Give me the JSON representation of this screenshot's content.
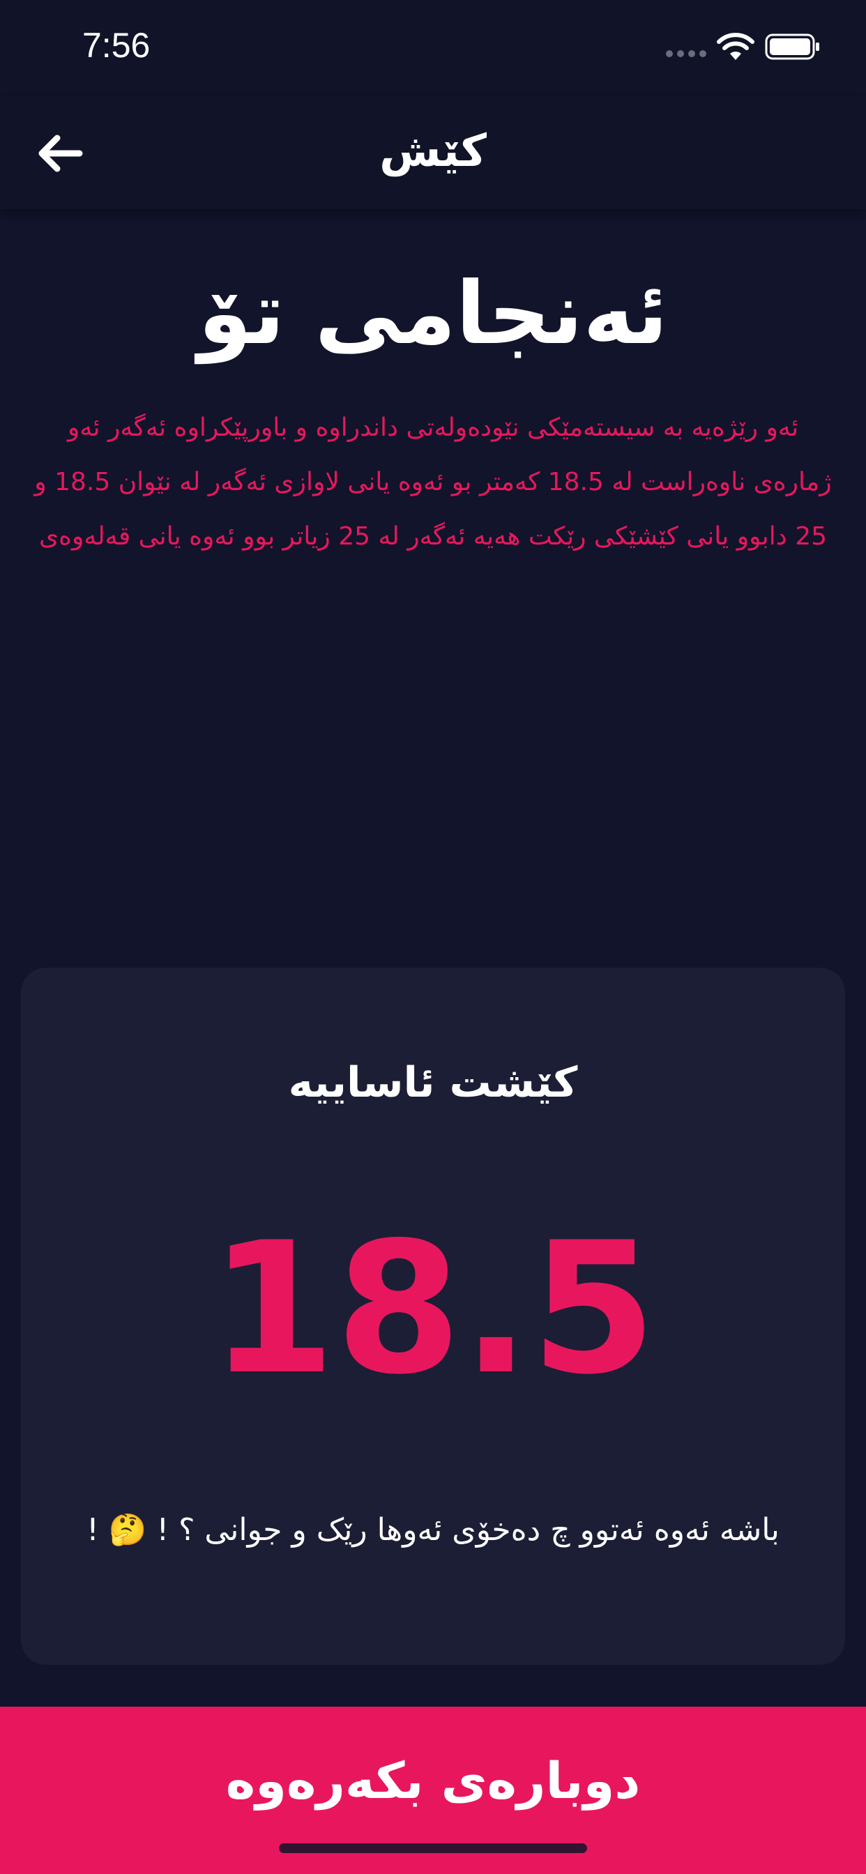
{
  "status_bar": {
    "time": "7:56",
    "icons": [
      "signal-icon",
      "wifi-icon",
      "battery-icon"
    ]
  },
  "nav": {
    "back_icon": "arrow-left-icon",
    "title": "کێش"
  },
  "result": {
    "heading": "ئەنجامی تۆ",
    "description": "ئەو رێژەیە بە سیستەمێکی نێودەولەتی داندراوە و باورپێکراوە ئەگەر ئەو ژمارەی ناوەراست لە 18.5 کەمتر بو ئەوە یانی لاوازی ئەگەر لە نێوان 18.5 و 25 دابوو یانی کێشێکی رێکت هەیە ئەگەر لە 25 زیاتر بوو ئەوە یانی قەلەوەی"
  },
  "card": {
    "title": "کێشت ئاساییە",
    "value": "18.5",
    "message": "باشە ئەوە ئەتوو چ دەخۆی ئەوها رێک و جوانی ؟ ! 🤔 !"
  },
  "action": {
    "retry_label": "دوبارەی بکەرەوە"
  },
  "colors": {
    "background": "#11142a",
    "card": "#1c1e35",
    "accent": "#e8175d",
    "text": "#ffffff"
  }
}
